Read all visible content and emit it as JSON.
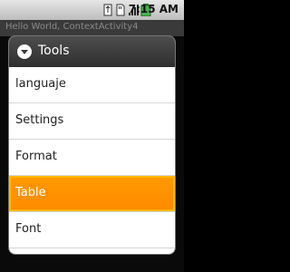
{
  "status_bar": {
    "time": "7:15 AM",
    "icons": [
      "usb-icon",
      "sd-card-icon",
      "signal-icon",
      "battery-icon"
    ]
  },
  "app": {
    "title": "Hello World, ContextActivity4"
  },
  "dialog": {
    "title": "Tools",
    "icon": "dropdown-circle-icon",
    "items": [
      {
        "label": "languaje",
        "selected": false
      },
      {
        "label": "Settings",
        "selected": false
      },
      {
        "label": "Format",
        "selected": false
      },
      {
        "label": "Table",
        "selected": true
      },
      {
        "label": "Font",
        "selected": false
      }
    ],
    "colors": {
      "header": "#3a3a3a",
      "selected": "#ff8c00",
      "panel": "#ffffff"
    }
  }
}
